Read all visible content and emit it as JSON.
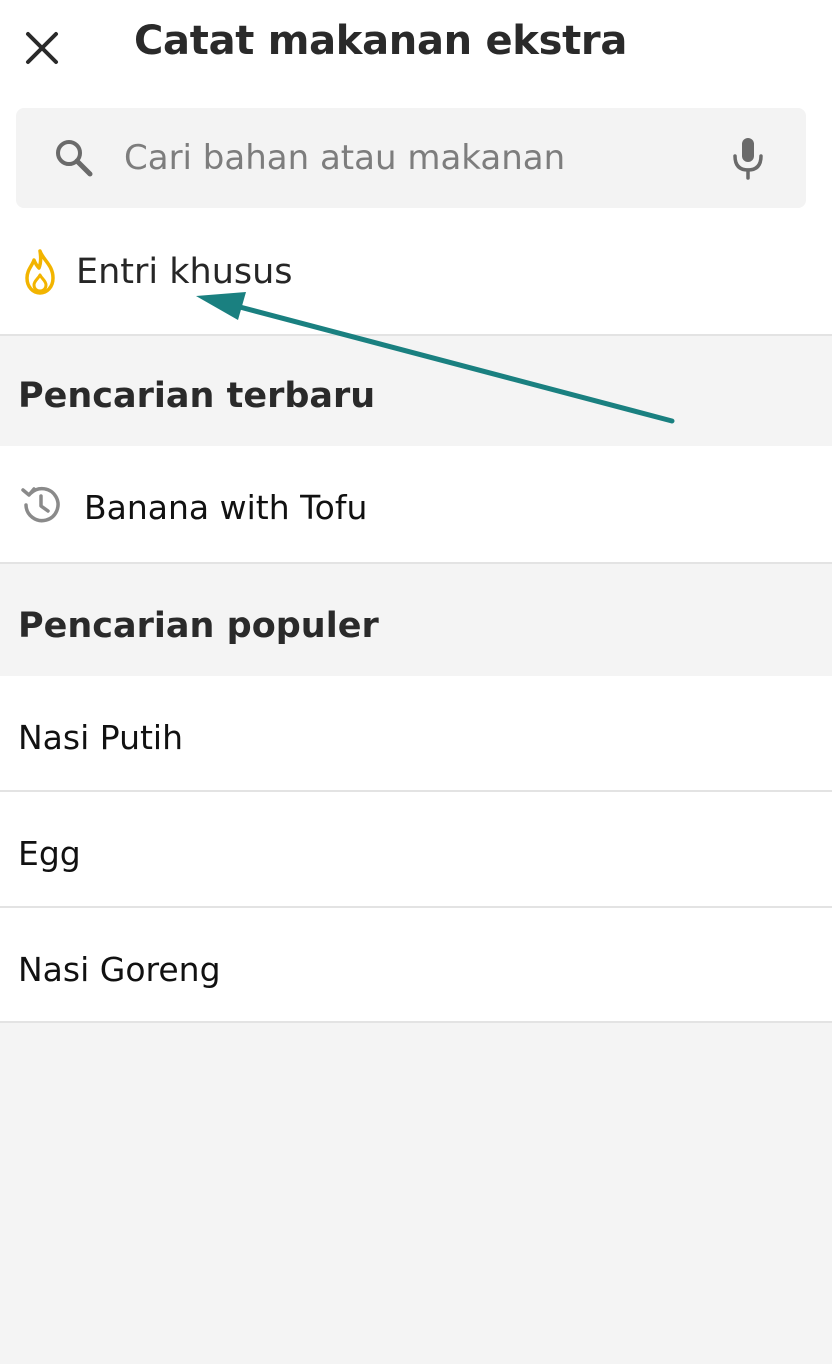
{
  "header": {
    "title": "Catat makanan ekstra",
    "close_icon": "close-icon"
  },
  "search": {
    "placeholder": "Cari bahan atau makanan",
    "value": "",
    "search_icon": "search-icon",
    "mic_icon": "microphone-icon"
  },
  "custom_entry": {
    "label": "Entri khusus",
    "icon": "flame-icon",
    "icon_color": "#f2b400"
  },
  "recent": {
    "title": "Pencarian terbaru",
    "items": [
      {
        "label": "Banana with Tofu",
        "icon": "history-icon"
      }
    ]
  },
  "popular": {
    "title": "Pencarian populer",
    "items": [
      {
        "label": "Nasi Putih"
      },
      {
        "label": "Egg"
      },
      {
        "label": "Nasi Goreng"
      }
    ]
  },
  "annotation": {
    "arrow_color": "#1a8080"
  }
}
